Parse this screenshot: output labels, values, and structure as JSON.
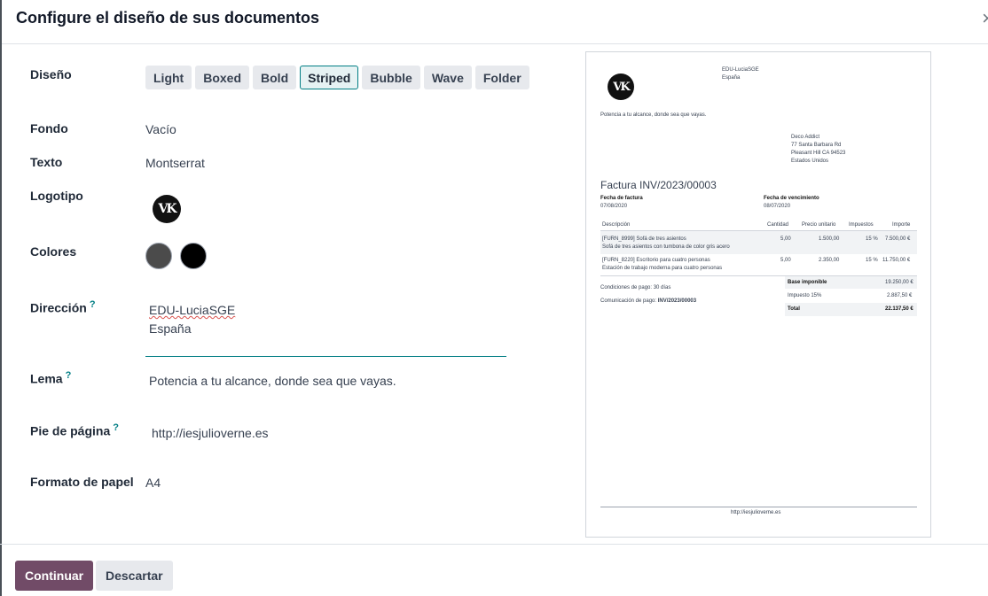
{
  "dialog": {
    "title": "Configure el diseño de sus documentos",
    "close_icon": "×"
  },
  "form": {
    "layout_label": "Diseño",
    "layouts": [
      "Light",
      "Boxed",
      "Bold",
      "Striped",
      "Bubble",
      "Wave",
      "Folder"
    ],
    "selected_layout": "Striped",
    "background_label": "Fondo",
    "background_value": "Vacío",
    "font_label": "Texto",
    "font_value": "Montserrat",
    "logo_label": "Logotipo",
    "logo_text": "VK",
    "colors_label": "Colores",
    "colors": [
      "#4b4b4b",
      "#000000"
    ],
    "address_label": "Dirección",
    "address_help": "?",
    "address_lines": [
      "EDU-LuciaSGE",
      "España"
    ],
    "tagline_label": "Lema",
    "tagline_help": "?",
    "tagline_value": "Potencia a tu alcance, donde sea que vayas.",
    "footer_label": "Pie de página",
    "footer_help": "?",
    "footer_value": "http://iesjulioverne.es",
    "paper_label": "Formato de papel",
    "paper_value": "A4"
  },
  "preview": {
    "company_name": "EDU-LuciaSGE",
    "company_country": "España",
    "tagline": "Potencia a tu alcance, donde sea que vayas.",
    "customer": [
      "Deco Addict",
      "77 Santa Barbara Rd",
      "Pleasant Hill CA 94523",
      "Estados Unidos"
    ],
    "invoice_title": "Factura INV/2023/00003",
    "invoice_date_label": "Fecha de factura",
    "invoice_date": "07/08/2020",
    "due_date_label": "Fecha de vencimiento",
    "due_date": "08/07/2020",
    "columns": [
      "Descripción",
      "Cantidad",
      "Precio unitario",
      "Impuestos",
      "Importe"
    ],
    "lines": [
      {
        "desc1": "[FURN_8999] Sofá de tres asientos",
        "desc2": "Sofá de tres asientos con tumbona de color gris acero",
        "qty": "5,00",
        "price": "1.500,00",
        "tax": "15 %",
        "amount": "7.500,00 €"
      },
      {
        "desc1": "[FURN_8220] Escritorio para cuatro personas",
        "desc2": "Estación de trabajo moderna para cuatro personas",
        "qty": "5,00",
        "price": "2.350,00",
        "tax": "15 %",
        "amount": "11.750,00 €"
      }
    ],
    "payment_terms": "Condiciones de pago: 30 días",
    "payment_ref_label": "Comunicación de pago:",
    "payment_ref": "INV/2023/00003",
    "subtotal_label": "Base imponible",
    "subtotal": "19.250,00 €",
    "tax_label": "Impuesto 15%",
    "tax": "2.887,50 €",
    "total_label": "Total",
    "total": "22.137,50 €",
    "footer_url": "http://iesjulioverne.es"
  },
  "buttons": {
    "continue": "Continuar",
    "discard": "Descartar"
  }
}
